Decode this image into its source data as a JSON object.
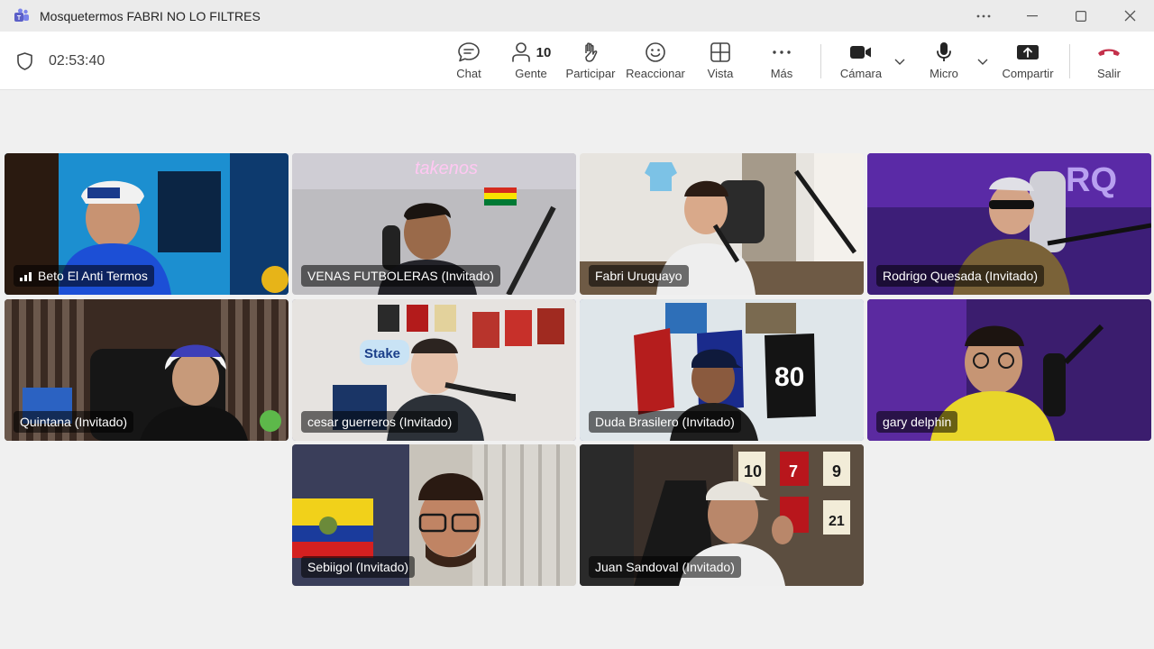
{
  "window": {
    "title": "Mosquetermos FABRI NO LO FILTRES",
    "controls": [
      "more-options",
      "minimize",
      "maximize",
      "close"
    ]
  },
  "toolbar": {
    "timer": "02:53:40",
    "chat_label": "Chat",
    "people_label": "Gente",
    "people_count": "10",
    "raise_hand_label": "Participar",
    "react_label": "Reaccionar",
    "view_label": "Vista",
    "more_label": "Más",
    "camera_label": "Cámara",
    "mic_label": "Micro",
    "share_label": "Compartir",
    "leave_label": "Salir",
    "leave_color": "#c4314b",
    "accent_color": "#6264a7"
  },
  "participants": [
    {
      "name": "Beto El Anti Termos",
      "row": 1,
      "col": 1,
      "signal_icon": true,
      "active": false
    },
    {
      "name": "VENAS FUTBOLERAS (Invitado)",
      "row": 1,
      "col": 2,
      "active": false
    },
    {
      "name": "Fabri Uruguayo",
      "row": 1,
      "col": 3,
      "active": false
    },
    {
      "name": "Rodrigo Quesada (Invitado)",
      "row": 1,
      "col": 4,
      "active": false
    },
    {
      "name": "Quintana (Invitado)",
      "row": 2,
      "col": 1,
      "active": false
    },
    {
      "name": "cesar guerreros (Invitado)",
      "row": 2,
      "col": 2,
      "active": true
    },
    {
      "name": "Duda Brasilero (Invitado)",
      "row": 2,
      "col": 3,
      "active": true
    },
    {
      "name": "gary delphin",
      "row": 2,
      "col": 4,
      "active": true
    },
    {
      "name": "Sebiigol (Invitado)",
      "row": 3,
      "col": 2,
      "active": false
    },
    {
      "name": "Juan Sandoval (Invitado)",
      "row": 3,
      "col": 3,
      "active": false
    }
  ]
}
